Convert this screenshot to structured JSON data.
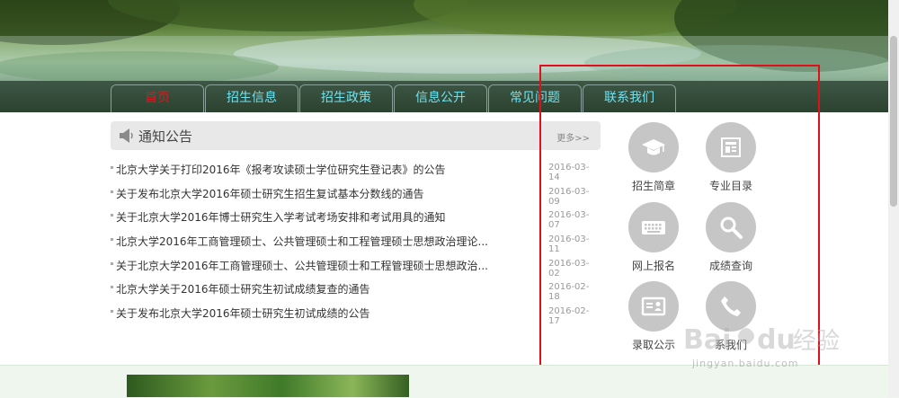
{
  "nav": {
    "tabs": [
      {
        "label": "首页",
        "active": true
      },
      {
        "label": "招生信息"
      },
      {
        "label": "招生政策"
      },
      {
        "label": "信息公开"
      },
      {
        "label": "常见问题"
      },
      {
        "label": "联系我们"
      }
    ]
  },
  "notice": {
    "title": "通知公告",
    "more": "更多>>",
    "items": [
      {
        "text": "北京大学关于打印2016年《报考攻读硕士学位研究生登记表》的公告",
        "date": "2016-03-14"
      },
      {
        "text": "关于发布北京大学2016年硕士研究生招生复试基本分数线的通告",
        "date": "2016-03-09"
      },
      {
        "text": "关于北京大学2016年博士研究生入学考试考场安排和考试用具的通知",
        "date": "2016-03-07"
      },
      {
        "text": "北京大学2016年工商管理硕士、公共管理硕士和工程管理硕士思想政治理论...",
        "date": "2016-03-11"
      },
      {
        "text": "关于北京大学2016年工商管理硕士、公共管理硕士和工程管理硕士思想政治...",
        "date": "2016-03-02"
      },
      {
        "text": "北京大学关于2016年硕士研究生初试成绩复查的通告",
        "date": "2016-02-18"
      },
      {
        "text": "关于发布北京大学2016年硕士研究生初试成绩的公告",
        "date": "2016-02-17"
      }
    ]
  },
  "quick_links": [
    {
      "label": "招生简章",
      "icon": "graduation-cap-icon"
    },
    {
      "label": "专业目录",
      "icon": "catalog-icon"
    },
    {
      "label": "网上报名",
      "icon": "keyboard-icon"
    },
    {
      "label": "成绩查询",
      "icon": "search-icon"
    },
    {
      "label": "录取公示",
      "icon": "id-card-icon"
    },
    {
      "label": "系我们",
      "icon": "phone-icon"
    }
  ],
  "watermark": {
    "brand": "Bai du 经验",
    "sub": "jingyan.baidu.com"
  },
  "colors": {
    "nav_text": "#6fe2f0",
    "nav_active": "#e4141b",
    "highlight_box": "#e0101a",
    "icon_circle": "#c6c6c6"
  }
}
